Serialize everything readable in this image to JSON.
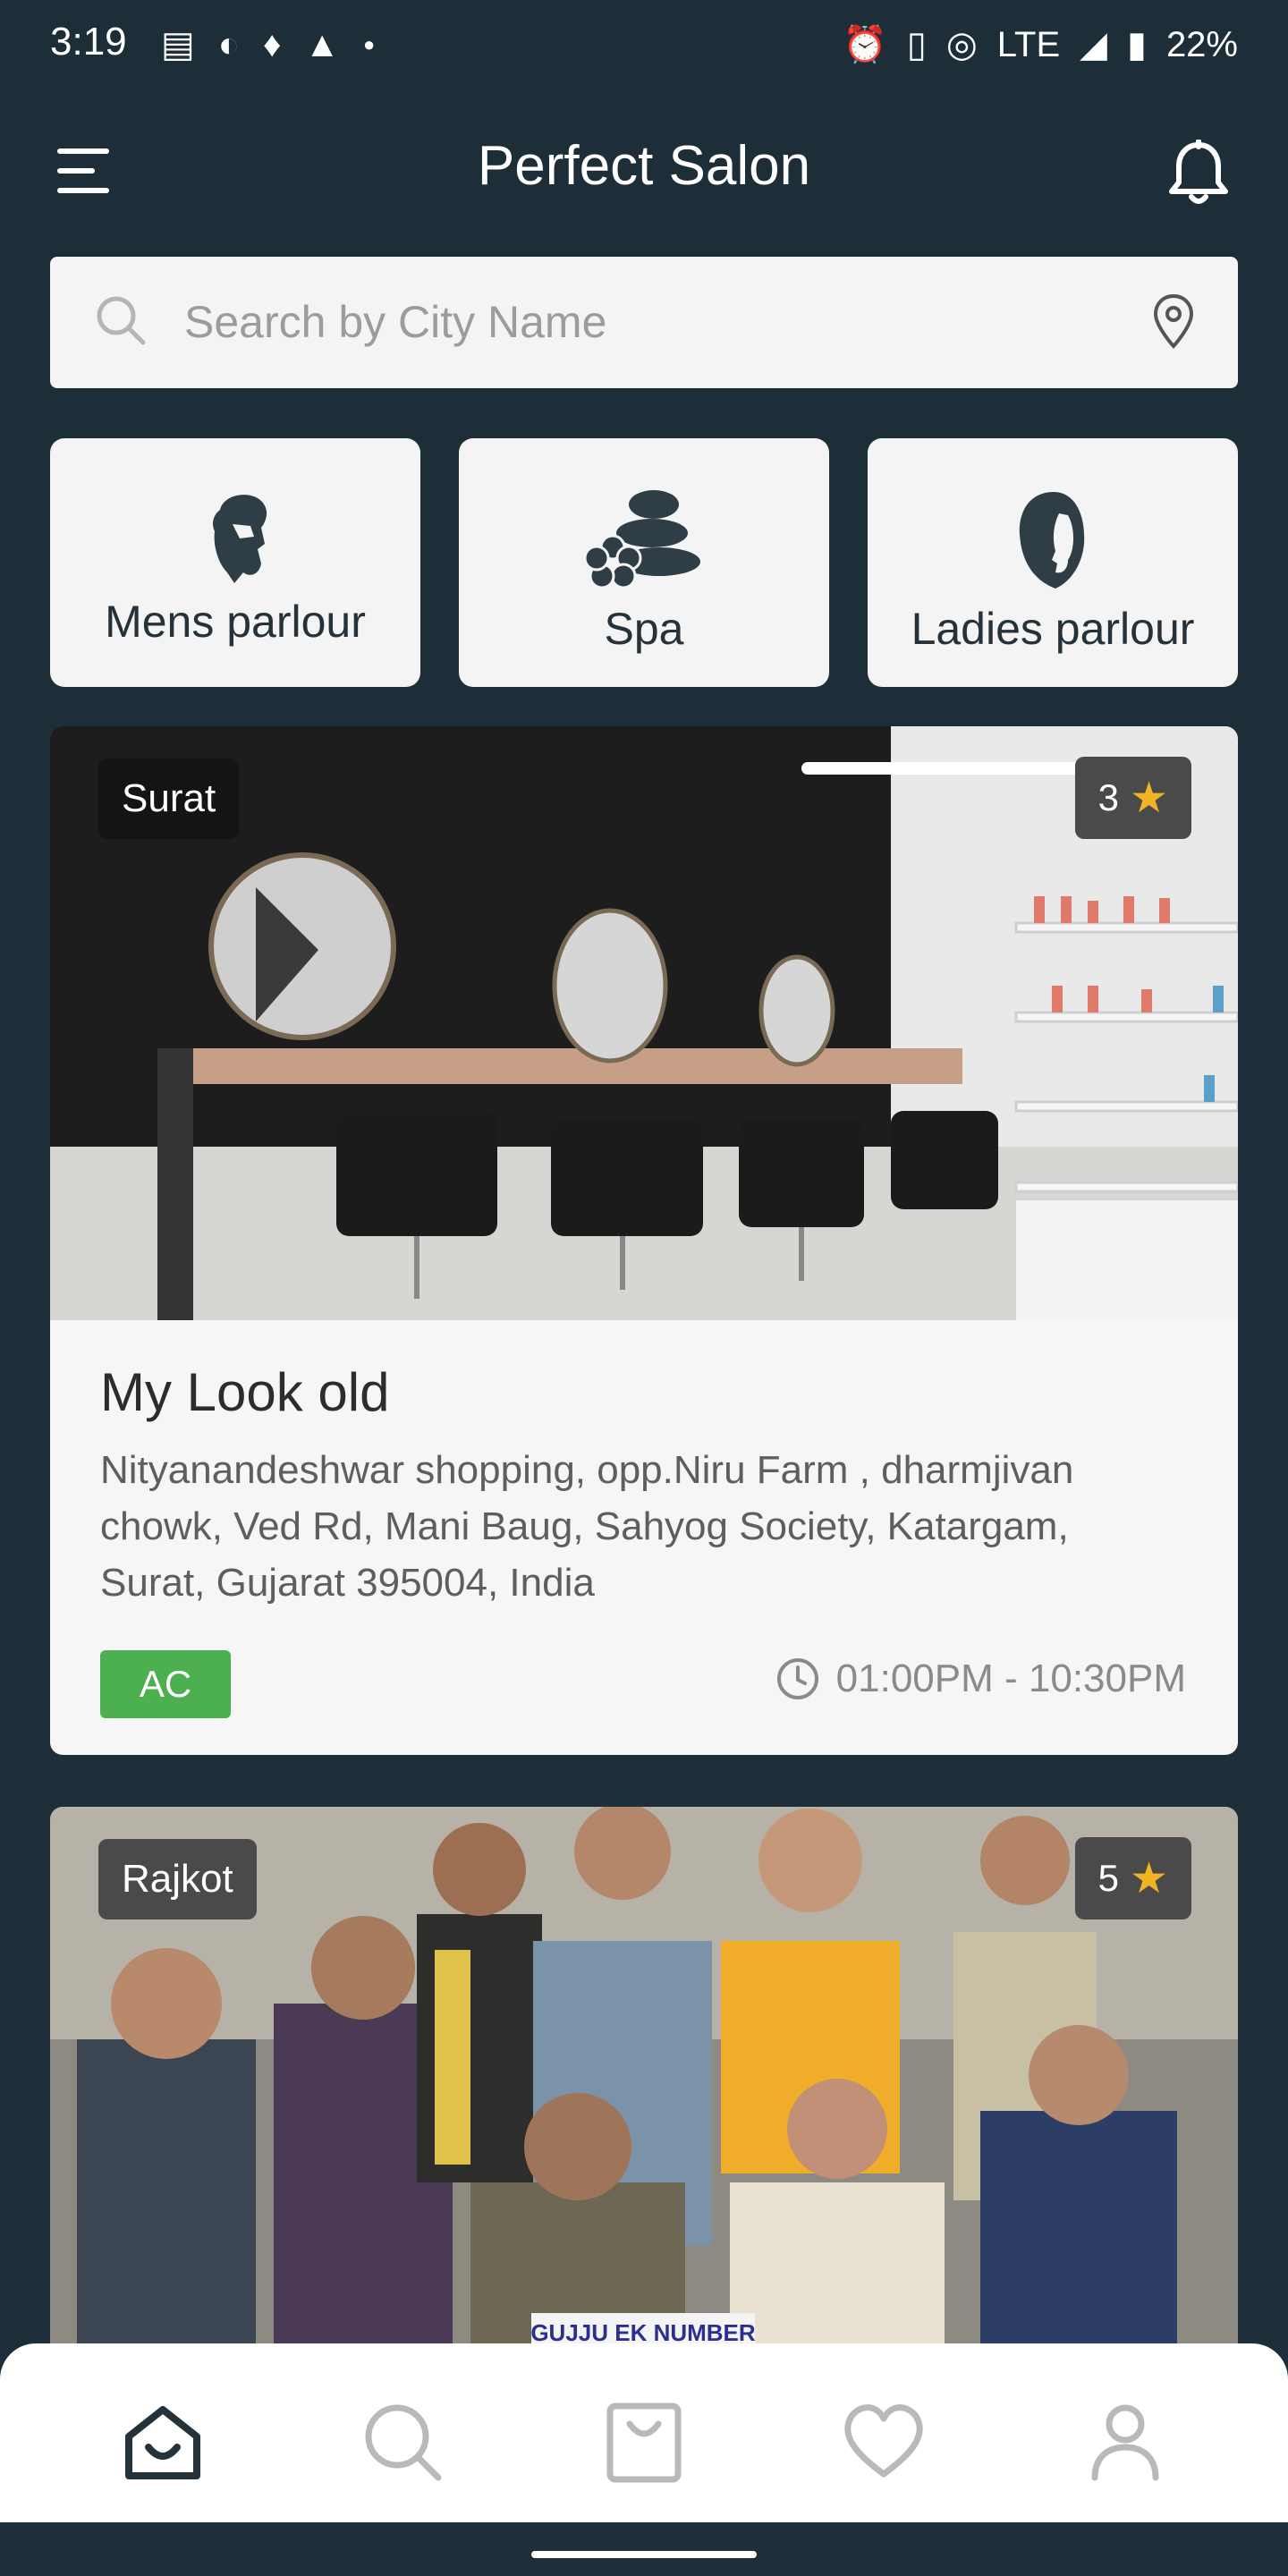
{
  "status_bar": {
    "time": "3:19",
    "network": "LTE",
    "battery": "22%"
  },
  "app_bar": {
    "title": "Perfect Salon"
  },
  "search": {
    "placeholder": "Search by City Name"
  },
  "categories": [
    {
      "label": "Mens parlour",
      "icon": "man-beard-icon"
    },
    {
      "label": "Spa",
      "icon": "spa-stones-icon"
    },
    {
      "label": "Ladies parlour",
      "icon": "woman-face-icon"
    }
  ],
  "salons": [
    {
      "city": "Surat",
      "rating": "3",
      "name": "My Look old",
      "address": "Nityanandeshwar shopping, opp.Niru Farm , dharmjivan chowk, Ved Rd, Mani Baug, Sahyog Society, Katargam, Surat, Gujarat 395004, India",
      "tag": "AC",
      "hours": "01:00PM - 10:30PM"
    },
    {
      "city": "Rajkot",
      "rating": "5",
      "poster_text": "GUJJU EK NUMBER"
    }
  ],
  "bottom_nav": [
    {
      "name": "home",
      "icon": "home-icon",
      "active": true
    },
    {
      "name": "search",
      "icon": "search-icon",
      "active": false
    },
    {
      "name": "bookings",
      "icon": "bag-icon",
      "active": false
    },
    {
      "name": "favorites",
      "icon": "heart-icon",
      "active": false
    },
    {
      "name": "profile",
      "icon": "person-icon",
      "active": false
    }
  ],
  "colors": {
    "background": "#1e2e38",
    "card": "#f7f6f7",
    "accent_green": "#4caf50",
    "star": "#f0b323",
    "nav_active": "#26323a",
    "nav_inactive": "#b9b9b9"
  }
}
